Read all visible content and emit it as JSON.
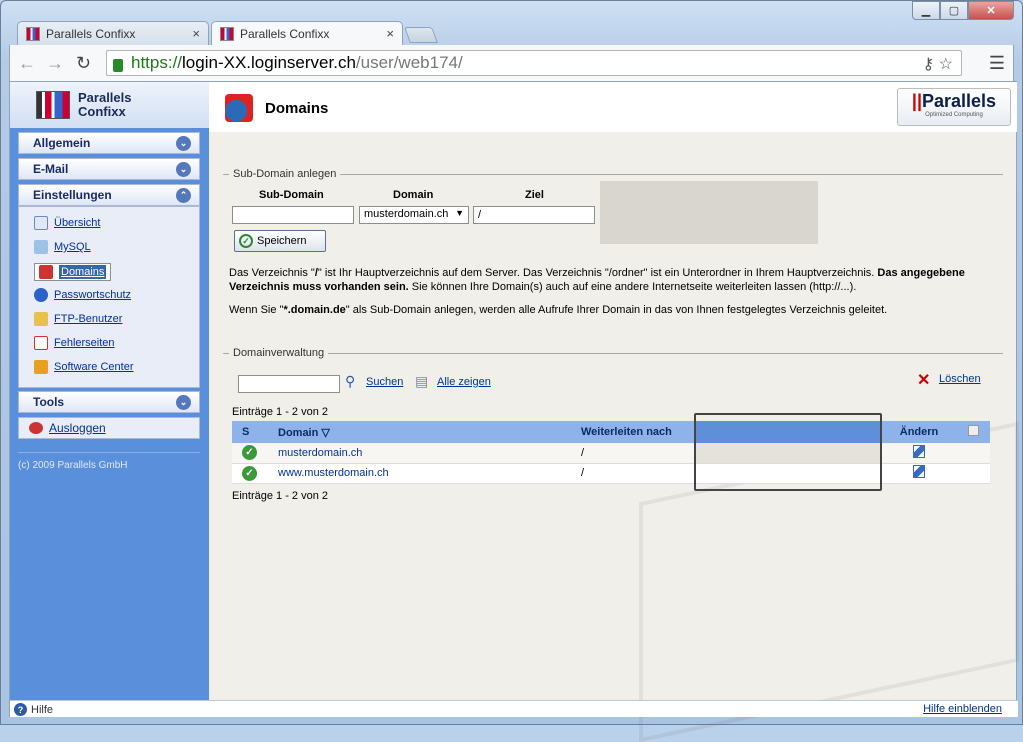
{
  "browser": {
    "tabs": [
      {
        "title": "Parallels Confixx"
      },
      {
        "title": "Parallels Confixx"
      }
    ],
    "url": {
      "https": "https://",
      "host": "login-XX.loginserver.ch",
      "path": "/user/web174/"
    }
  },
  "sidebar": {
    "logo_line1": "Parallels",
    "logo_line2": "Confixx",
    "sections": {
      "allgemein": "Allgemein",
      "email": "E-Mail",
      "einstellungen": "Einstellungen",
      "tools": "Tools"
    },
    "items": [
      {
        "label": "Übersicht",
        "icon": "overview-icon"
      },
      {
        "label": "MySQL",
        "icon": "mysql-icon"
      },
      {
        "label": "Domains",
        "icon": "domains-icon"
      },
      {
        "label": "Passwortschutz",
        "icon": "lock-icon"
      },
      {
        "label": "FTP-Benutzer",
        "icon": "ftp-user-icon"
      },
      {
        "label": "Fehlerseiten",
        "icon": "error-page-icon"
      },
      {
        "label": "Software Center",
        "icon": "software-icon"
      }
    ],
    "logout": "Ausloggen",
    "copyright": "(c) 2009 Parallels GmbH"
  },
  "main": {
    "title": "Domains",
    "brand": {
      "name": "Parallels",
      "tagline": "Optimized Computing"
    },
    "subdomain": {
      "legend": "Sub-Domain anlegen",
      "col_subdomain": "Sub-Domain",
      "col_domain": "Domain",
      "col_ziel": "Ziel",
      "subdomain_value": "",
      "domain_value": "musterdomain.ch",
      "ziel_value": "/",
      "save": "Speichern",
      "info1_a": "Das Verzeichnis \"",
      "info1_b": "/",
      "info1_c": "\" ist Ihr Hauptverzeichnis auf dem Server. Das Verzeichnis \"/ordner\" ist ein Unterordner in Ihrem Hauptverzeichnis. ",
      "info1_d": "Das angegebene Verzeichnis muss vorhanden sein.",
      "info1_e": " Sie können Ihre Domain(s) auch auf eine andere Internetseite weiterleiten lassen (http://...).",
      "info2_a": "Wenn Sie \"",
      "info2_b": "*.domain.de",
      "info2_c": "\" als Sub-Domain anlegen, werden alle Aufrufe Ihrer Domain in das von Ihnen festgelegtes Verzeichnis geleitet."
    },
    "domainverwaltung": {
      "legend": "Domainverwaltung",
      "search_value": "",
      "search": "Suchen",
      "show_all": "Alle zeigen",
      "delete": "Löschen",
      "count_top": "Einträge 1 - 2 von 2",
      "count_bottom": "Einträge 1 - 2 von 2",
      "columns": {
        "s": "S",
        "domain": "Domain",
        "sort": "▽",
        "forward": "Weiterleiten nach",
        "edit": "Ändern"
      },
      "rows": [
        {
          "domain": "musterdomain.ch",
          "forward": "/"
        },
        {
          "domain": "www.musterdomain.ch",
          "forward": "/"
        }
      ]
    }
  },
  "footer": {
    "help": "Hilfe",
    "show_help": "Hilfe einblenden"
  }
}
